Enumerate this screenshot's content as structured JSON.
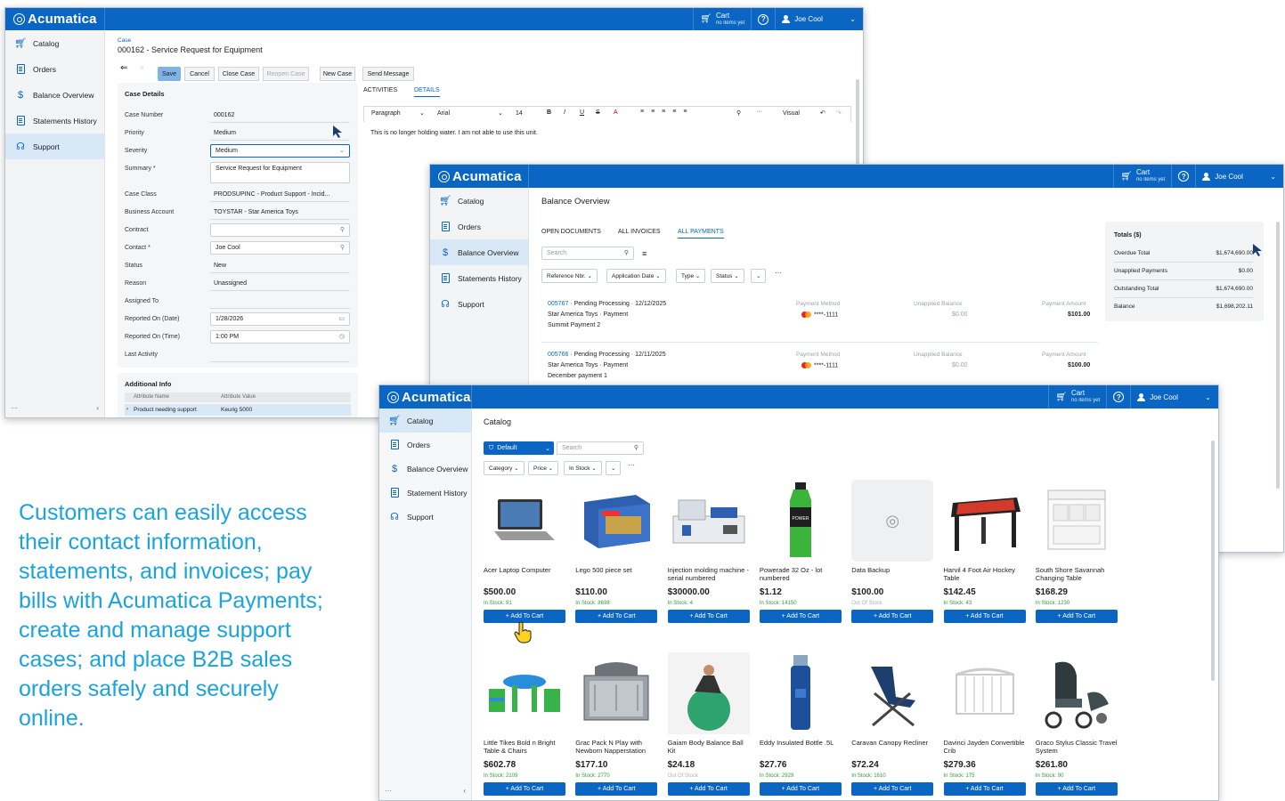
{
  "app": {
    "brand": "Acumatica",
    "cart_label": "Cart",
    "cart_sub": "no items yet",
    "user": "Joe Cool"
  },
  "nav": {
    "catalog": "Catalog",
    "orders": "Orders",
    "balance": "Balance Overview",
    "statements": "Statements History",
    "statements_alt": "Statement History",
    "support": "Support"
  },
  "case": {
    "crumb": "Case",
    "title": "000162 - Service Request for Equipment",
    "toolbar": {
      "save": "Save",
      "cancel": "Cancel",
      "close": "Close Case",
      "reopen": "Reopen Case",
      "new": "New Case",
      "send": "Send Message"
    },
    "section": "Case Details",
    "fields": {
      "case_number": {
        "label": "Case Number",
        "value": "000162"
      },
      "priority": {
        "label": "Priority",
        "value": "Medium"
      },
      "severity": {
        "label": "Severity",
        "value": "Medium"
      },
      "summary": {
        "label": "Summary *",
        "value": "Service Request for Equipment"
      },
      "case_class": {
        "label": "Case Class",
        "value": "PRODSUPINC - Product Support - Incid..."
      },
      "business_account": {
        "label": "Business Account",
        "value": "TOYSTAR - Star America Toys"
      },
      "contract": {
        "label": "Contract",
        "value": ""
      },
      "contact": {
        "label": "Contact *",
        "value": "Joe Cool"
      },
      "status": {
        "label": "Status",
        "value": "New"
      },
      "reason": {
        "label": "Reason",
        "value": "Unassigned"
      },
      "assigned_to": {
        "label": "Assigned To",
        "value": ""
      },
      "reported_date": {
        "label": "Reported On (Date)",
        "value": "1/28/2026"
      },
      "reported_time": {
        "label": "Reported On (Time)",
        "value": "1:00 PM"
      },
      "last_activity": {
        "label": "Last Activity",
        "value": ""
      }
    },
    "additional": {
      "title": "Additional Info",
      "col1": "Attribute Name",
      "col2": "Attribute Value",
      "row_name": "Product needing support",
      "row_value": "Keurig 5000"
    },
    "tabs": {
      "activities": "ACTIVITIES",
      "details": "DETAILS"
    },
    "editor": {
      "paragraph": "Paragraph",
      "font": "Arial",
      "size": "14",
      "visual": "Visual",
      "text": "This is no longer holding water. I am not able to use this unit."
    }
  },
  "balance": {
    "title": "Balance Overview",
    "tabs": {
      "open": "OPEN DOCUMENTS",
      "invoices": "ALL INVOICES",
      "payments": "ALL PAYMENTS"
    },
    "search_placeholder": "Search",
    "filters": {
      "ref": "Reference Nbr.",
      "appdate": "Application Date",
      "type": "Type",
      "status": "Status"
    },
    "cols": {
      "method": "Payment Method",
      "unapplied": "Unapplied Balance",
      "amount": "Payment Amount"
    },
    "rows": [
      {
        "ref": "005767",
        "status": "Pending Processing",
        "date": "12/12/2025",
        "customer": "Star America Toys",
        "type": "Payment",
        "desc": "Summit Payment 2",
        "card": "****-1111",
        "unapplied": "$0.00",
        "amount": "$101.00"
      },
      {
        "ref": "005766",
        "status": "Pending Processing",
        "date": "12/11/2025",
        "customer": "Star America Toys",
        "type": "Payment",
        "desc": "December payment 1",
        "card": "****-1111",
        "unapplied": "$0.00",
        "amount": "$100.00"
      }
    ],
    "totals": {
      "title": "Totals ($)",
      "rows": [
        {
          "label": "Overdue Total",
          "value": "$1,674,690.00"
        },
        {
          "label": "Unapplied Payments",
          "value": "$0.00"
        },
        {
          "label": "Outstanding Total",
          "value": "$1,674,690.00"
        },
        {
          "label": "Balance",
          "value": "$1,698,202.11"
        }
      ]
    }
  },
  "catalog": {
    "title": "Catalog",
    "default": "Default",
    "search_placeholder": "Search",
    "filters": {
      "category": "Category",
      "price": "Price",
      "stock": "In Stock"
    },
    "add_label": "+ Add To Cart",
    "products": [
      {
        "name": "Acer Laptop Computer",
        "price": "$500.00",
        "stock": "In Stock: 91",
        "icon": "laptop"
      },
      {
        "name": "Lego 500 piece set",
        "price": "$110.00",
        "stock": "In Stock: 8698",
        "icon": "lego-box"
      },
      {
        "name": "Injection molding machine - serial numbered",
        "price": "$30000.00",
        "stock": "In Stock: 4",
        "icon": "machine"
      },
      {
        "name": "Powerade 32 Oz - lot numbered",
        "price": "$1.12",
        "stock": "In Stock: 14150",
        "icon": "bottle-green"
      },
      {
        "name": "Data Backup",
        "price": "$100.00",
        "stock": "Out Of Stock",
        "icon": "camera-placeholder"
      },
      {
        "name": "Harvil 4 Foot Air Hockey Table",
        "price": "$142.45",
        "stock": "In Stock: 43",
        "icon": "hockey-table"
      },
      {
        "name": "South Shore Savannah Changing Table",
        "price": "$168.29",
        "stock": "In Stock: 1230",
        "icon": "changing-table"
      },
      {
        "name": "Little Tikes Bold n Bright Table & Chairs",
        "price": "$602.78",
        "stock": "In Stock: 2109",
        "icon": "kids-table"
      },
      {
        "name": "Grac Pack N Play with Newborn Napperstation",
        "price": "$177.10",
        "stock": "In Stock: 2770",
        "icon": "playpen"
      },
      {
        "name": "Gaiam Body Balance Ball Kit",
        "price": "$24.18",
        "stock": "Out Of Stock",
        "icon": "balance-ball"
      },
      {
        "name": "Eddy Insulated Bottle .5L",
        "price": "$27.76",
        "stock": "In Stock: 2929",
        "icon": "bottle-blue"
      },
      {
        "name": "Caravan Canopy Recliner",
        "price": "$72.24",
        "stock": "In Stock: 1610",
        "icon": "recliner"
      },
      {
        "name": "Davinci Jayden Convertible Crib",
        "price": "$279.36",
        "stock": "In Stock: 175",
        "icon": "crib"
      },
      {
        "name": "Graco Stylus Classic Travel System",
        "price": "$261.80",
        "stock": "In Stock: 90",
        "icon": "stroller"
      }
    ]
  },
  "caption": "Customers can easily access their contact information, statements, and invoices; pay bills with Acumatica Payments; create and manage support cases; and place B2B sales orders safely and securely online.",
  "colors": {
    "accent": "#0a66c2",
    "caption": "#1aa3dd",
    "in_stock": "#2e9b3a"
  }
}
